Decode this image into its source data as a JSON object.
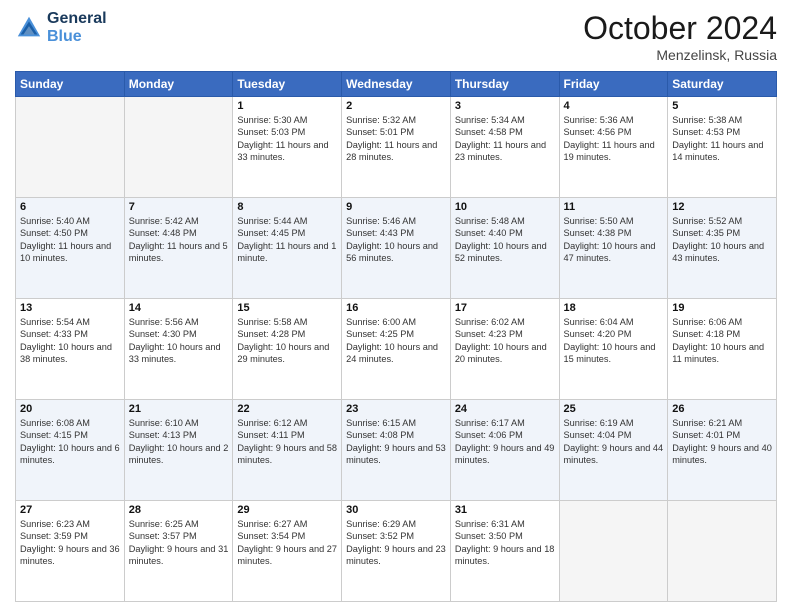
{
  "header": {
    "logo_line1": "General",
    "logo_line2": "Blue",
    "month": "October 2024",
    "location": "Menzelinsk, Russia"
  },
  "weekdays": [
    "Sunday",
    "Monday",
    "Tuesday",
    "Wednesday",
    "Thursday",
    "Friday",
    "Saturday"
  ],
  "weeks": [
    [
      {
        "day": "",
        "text": ""
      },
      {
        "day": "",
        "text": ""
      },
      {
        "day": "1",
        "text": "Sunrise: 5:30 AM\nSunset: 5:03 PM\nDaylight: 11 hours and 33 minutes."
      },
      {
        "day": "2",
        "text": "Sunrise: 5:32 AM\nSunset: 5:01 PM\nDaylight: 11 hours and 28 minutes."
      },
      {
        "day": "3",
        "text": "Sunrise: 5:34 AM\nSunset: 4:58 PM\nDaylight: 11 hours and 23 minutes."
      },
      {
        "day": "4",
        "text": "Sunrise: 5:36 AM\nSunset: 4:56 PM\nDaylight: 11 hours and 19 minutes."
      },
      {
        "day": "5",
        "text": "Sunrise: 5:38 AM\nSunset: 4:53 PM\nDaylight: 11 hours and 14 minutes."
      }
    ],
    [
      {
        "day": "6",
        "text": "Sunrise: 5:40 AM\nSunset: 4:50 PM\nDaylight: 11 hours and 10 minutes."
      },
      {
        "day": "7",
        "text": "Sunrise: 5:42 AM\nSunset: 4:48 PM\nDaylight: 11 hours and 5 minutes."
      },
      {
        "day": "8",
        "text": "Sunrise: 5:44 AM\nSunset: 4:45 PM\nDaylight: 11 hours and 1 minute."
      },
      {
        "day": "9",
        "text": "Sunrise: 5:46 AM\nSunset: 4:43 PM\nDaylight: 10 hours and 56 minutes."
      },
      {
        "day": "10",
        "text": "Sunrise: 5:48 AM\nSunset: 4:40 PM\nDaylight: 10 hours and 52 minutes."
      },
      {
        "day": "11",
        "text": "Sunrise: 5:50 AM\nSunset: 4:38 PM\nDaylight: 10 hours and 47 minutes."
      },
      {
        "day": "12",
        "text": "Sunrise: 5:52 AM\nSunset: 4:35 PM\nDaylight: 10 hours and 43 minutes."
      }
    ],
    [
      {
        "day": "13",
        "text": "Sunrise: 5:54 AM\nSunset: 4:33 PM\nDaylight: 10 hours and 38 minutes."
      },
      {
        "day": "14",
        "text": "Sunrise: 5:56 AM\nSunset: 4:30 PM\nDaylight: 10 hours and 33 minutes."
      },
      {
        "day": "15",
        "text": "Sunrise: 5:58 AM\nSunset: 4:28 PM\nDaylight: 10 hours and 29 minutes."
      },
      {
        "day": "16",
        "text": "Sunrise: 6:00 AM\nSunset: 4:25 PM\nDaylight: 10 hours and 24 minutes."
      },
      {
        "day": "17",
        "text": "Sunrise: 6:02 AM\nSunset: 4:23 PM\nDaylight: 10 hours and 20 minutes."
      },
      {
        "day": "18",
        "text": "Sunrise: 6:04 AM\nSunset: 4:20 PM\nDaylight: 10 hours and 15 minutes."
      },
      {
        "day": "19",
        "text": "Sunrise: 6:06 AM\nSunset: 4:18 PM\nDaylight: 10 hours and 11 minutes."
      }
    ],
    [
      {
        "day": "20",
        "text": "Sunrise: 6:08 AM\nSunset: 4:15 PM\nDaylight: 10 hours and 6 minutes."
      },
      {
        "day": "21",
        "text": "Sunrise: 6:10 AM\nSunset: 4:13 PM\nDaylight: 10 hours and 2 minutes."
      },
      {
        "day": "22",
        "text": "Sunrise: 6:12 AM\nSunset: 4:11 PM\nDaylight: 9 hours and 58 minutes."
      },
      {
        "day": "23",
        "text": "Sunrise: 6:15 AM\nSunset: 4:08 PM\nDaylight: 9 hours and 53 minutes."
      },
      {
        "day": "24",
        "text": "Sunrise: 6:17 AM\nSunset: 4:06 PM\nDaylight: 9 hours and 49 minutes."
      },
      {
        "day": "25",
        "text": "Sunrise: 6:19 AM\nSunset: 4:04 PM\nDaylight: 9 hours and 44 minutes."
      },
      {
        "day": "26",
        "text": "Sunrise: 6:21 AM\nSunset: 4:01 PM\nDaylight: 9 hours and 40 minutes."
      }
    ],
    [
      {
        "day": "27",
        "text": "Sunrise: 6:23 AM\nSunset: 3:59 PM\nDaylight: 9 hours and 36 minutes."
      },
      {
        "day": "28",
        "text": "Sunrise: 6:25 AM\nSunset: 3:57 PM\nDaylight: 9 hours and 31 minutes."
      },
      {
        "day": "29",
        "text": "Sunrise: 6:27 AM\nSunset: 3:54 PM\nDaylight: 9 hours and 27 minutes."
      },
      {
        "day": "30",
        "text": "Sunrise: 6:29 AM\nSunset: 3:52 PM\nDaylight: 9 hours and 23 minutes."
      },
      {
        "day": "31",
        "text": "Sunrise: 6:31 AM\nSunset: 3:50 PM\nDaylight: 9 hours and 18 minutes."
      },
      {
        "day": "",
        "text": ""
      },
      {
        "day": "",
        "text": ""
      }
    ]
  ]
}
